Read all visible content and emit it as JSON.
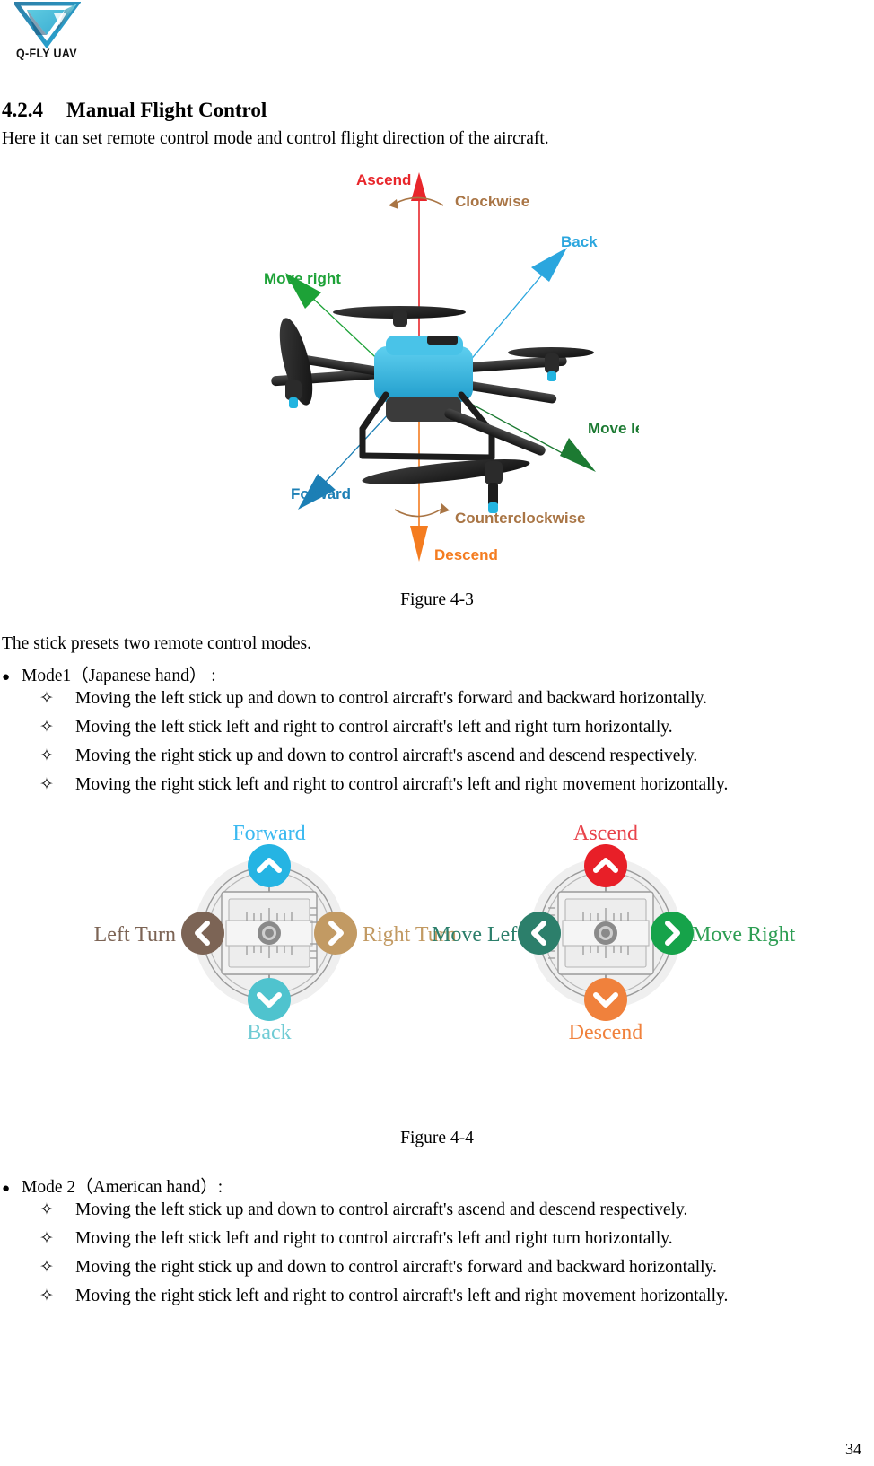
{
  "logo": {
    "text": "Q-FLY UAV",
    "icon": "qfly-triangle-logo"
  },
  "section": {
    "number": "4.2.4",
    "title": "Manual Flight Control",
    "intro": "Here it can set remote control mode and control flight direction of the aircraft."
  },
  "figure43": {
    "caption": "Figure 4-3",
    "alt": "Quadcopter drone with directional movement arrows",
    "labels": {
      "ascend": "Ascend",
      "clockwise": "Clockwise",
      "back": "Back",
      "move_right": "Move right",
      "move_left": "Move left",
      "forward": "Forward",
      "counterclockwise": "Counterclockwise",
      "descend": "Descend"
    },
    "colors": {
      "ascend": "#E8262B",
      "descend": "#F47C20",
      "clockwise": "#A97545",
      "counterclockwise": "#A97545",
      "back": "#2BA6DE",
      "forward": "#1C7FB5",
      "move_right": "#1DA237",
      "move_left": "#1C7A32",
      "body": "#2BB2E0"
    }
  },
  "stick_intro": "The stick presets two remote control modes.",
  "mode1": {
    "bullet": "Mode1（Japanese hand）  :",
    "items": [
      "Moving the left stick up and down to control aircraft's forward and backward horizontally.",
      "Moving the left stick left and right to control aircraft's left and right turn horizontally.",
      "Moving the right stick up and down to control aircraft's ascend and descend respectively.",
      "Moving the right stick left and right to control aircraft's left and right movement horizontally."
    ]
  },
  "figure44": {
    "caption": "Figure 4-4",
    "left_stick": {
      "up": "Forward",
      "down": "Back",
      "left": "Left Turn",
      "right": "Right Turn",
      "colors": {
        "up": "#25B4E3",
        "down": "#4FC3CE",
        "left": "#7C6455",
        "right": "#C29A63",
        "up_text": "#3BB9F0",
        "down_text": "#6FCBD4",
        "left_text": "#7C6455",
        "right_text": "#C29A63"
      }
    },
    "right_stick": {
      "up": "Ascend",
      "down": "Descend",
      "left": "Move Left",
      "right": "Move Right",
      "colors": {
        "up": "#E81F28",
        "down": "#F0813C",
        "left": "#2C7F6B",
        "right": "#16A34A",
        "up_text": "#E8434B",
        "down_text": "#F0813C",
        "left_text": "#2C7F6B",
        "right_text": "#2E9E54"
      }
    }
  },
  "mode2": {
    "bullet": "Mode 2（American hand）:",
    "items": [
      "Moving the left stick up and down to control aircraft's ascend and descend respectively.",
      "Moving the left stick left and right to control aircraft's left and right turn horizontally.",
      "Moving the right stick up and down to control aircraft's forward and backward horizontally.",
      "Moving the right stick left and right to control aircraft's left and right movement horizontally."
    ]
  },
  "footer": {
    "page_number": "34"
  }
}
